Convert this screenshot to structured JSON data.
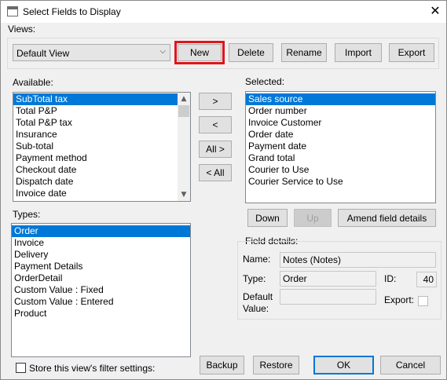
{
  "window": {
    "title": "Select Fields to Display",
    "close_glyph": "✕"
  },
  "views": {
    "group_label": "Views:",
    "selected_view": "Default View",
    "buttons": {
      "new": "New",
      "delete": "Delete",
      "rename": "Rename",
      "import": "Import",
      "export": "Export"
    },
    "highlight_color": "#e0141e"
  },
  "available": {
    "label": "Available:",
    "items": [
      "SubTotal tax",
      "Total P&P",
      "Total P&P tax",
      "Insurance",
      "Sub-total",
      "Payment method",
      "Checkout date",
      "Dispatch date",
      "Invoice date"
    ],
    "selected_index": 0
  },
  "move_buttons": {
    "add": ">",
    "remove": "<",
    "add_all": "All >",
    "remove_all": "< All"
  },
  "selected": {
    "label": "Selected:",
    "items": [
      "Sales source",
      "Order number",
      "Invoice Customer",
      "Order date",
      "Payment date",
      "Grand total",
      "Courier to Use",
      "Courier Service to Use"
    ],
    "selected_index": 0,
    "buttons": {
      "down": "Down",
      "up": "Up",
      "amend": "Amend field details"
    }
  },
  "types": {
    "label": "Types:",
    "items": [
      "Order",
      "Invoice",
      "Delivery",
      "Payment Details",
      "OrderDetail",
      "Custom Value : Fixed",
      "Custom Value : Entered",
      "Product"
    ],
    "selected_index": 0
  },
  "field_details": {
    "label": "Field details:",
    "name_label": "Name:",
    "name_value": "Notes (Notes)",
    "type_label": "Type:",
    "type_value": "Order",
    "id_label": "ID:",
    "id_value": "40",
    "default_label": "Default Value:",
    "default_value": "",
    "export_label": "Export:"
  },
  "footer": {
    "store_filter_label": "Store this view's filter settings:",
    "buttons": {
      "backup": "Backup",
      "restore": "Restore",
      "ok": "OK",
      "cancel": "Cancel"
    }
  },
  "colors": {
    "selection": "#0078d7",
    "default_button_border": "#0078d7"
  }
}
